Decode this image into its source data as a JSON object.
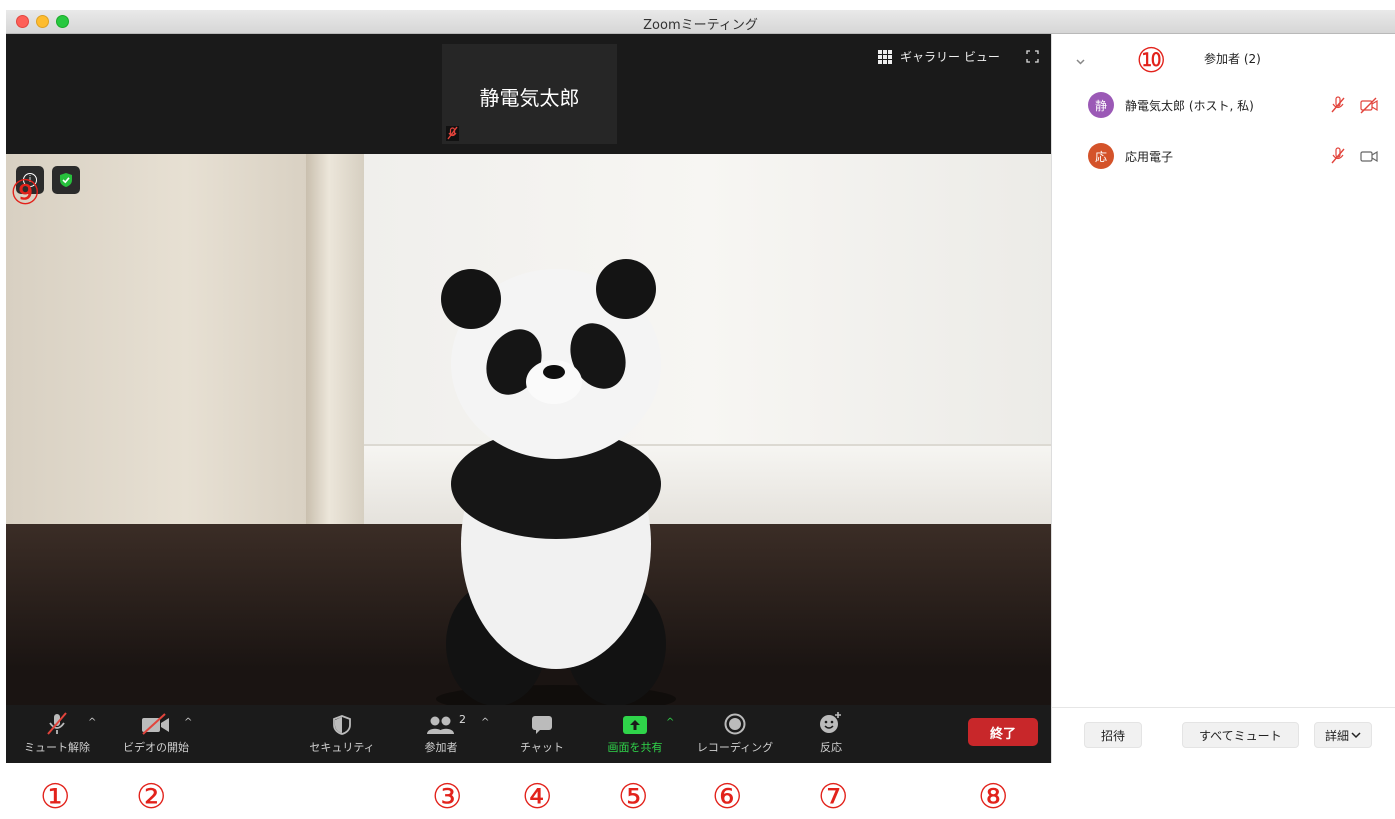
{
  "window": {
    "title": "Zoomミーティング"
  },
  "strip": {
    "thumbnail_name": "静電気太郎",
    "gallery_view_label": "ギャラリー ビュー"
  },
  "toolbar": {
    "unmute_label": "ミュート解除",
    "start_video_label": "ビデオの開始",
    "security_label": "セキュリティ",
    "participants_label": "参加者",
    "participants_count": "2",
    "chat_label": "チャット",
    "share_screen_label": "画面を共有",
    "recording_label": "レコーディング",
    "reactions_label": "反応",
    "end_label": "終了"
  },
  "panel": {
    "title": "参加者 (2)",
    "participants": [
      {
        "initial": "静",
        "name": "静電気太郎 (ホスト, 私)",
        "avatar_color": "#9b59b6"
      },
      {
        "initial": "応",
        "name": "応用電子",
        "avatar_color": "#d4532a"
      }
    ],
    "invite_label": "招待",
    "mute_all_label": "すべてミュート",
    "more_label": "詳細"
  },
  "annotations": [
    "①",
    "②",
    "③",
    "④",
    "⑤",
    "⑥",
    "⑦",
    "⑧",
    "⑨",
    "⑩"
  ],
  "colors": {
    "annotation_red": "#e2221b",
    "end_button": "#c8272a",
    "share_green": "#2fd44a",
    "muted_red": "#e2443c"
  }
}
